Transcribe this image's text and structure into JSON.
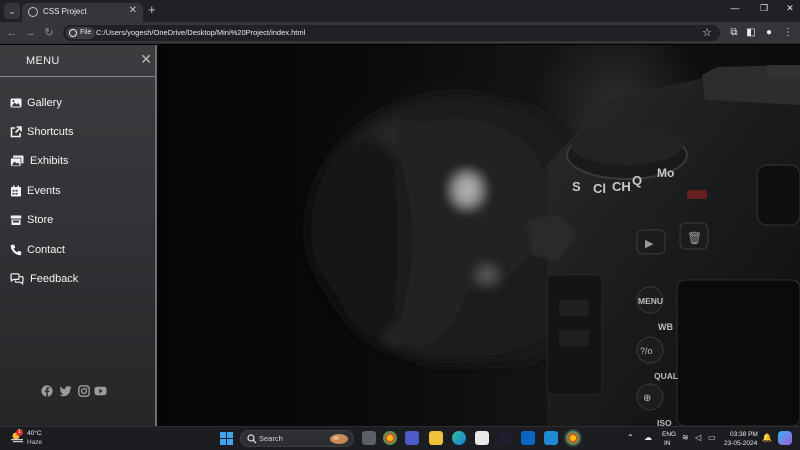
{
  "browser": {
    "tab_title": "CSS Project",
    "tab_list_icon": "chevron-down-icon",
    "new_tab_label": "+",
    "file_chip": "File",
    "url": "C:/Users/yogesh/OneDrive/Desktop/Mini%20Project/index.html"
  },
  "sidebar": {
    "title": "MENU",
    "close_label": "✕",
    "items": [
      {
        "label": "Gallery",
        "icon": "image-icon"
      },
      {
        "label": "Shortcuts",
        "icon": "external-link-icon"
      },
      {
        "label": "Exhibits",
        "icon": "images-icon"
      },
      {
        "label": "Events",
        "icon": "calendar-icon"
      },
      {
        "label": "Store",
        "icon": "store-icon"
      },
      {
        "label": "Contact",
        "icon": "phone-icon"
      },
      {
        "label": "Feedback",
        "icon": "comments-icon"
      }
    ],
    "social": [
      "facebook-icon",
      "twitter-icon",
      "instagram-icon",
      "youtube-icon"
    ]
  },
  "hero": {
    "camera_labels": [
      "MENU",
      "WB",
      "QUAL",
      "ISO"
    ]
  },
  "taskbar": {
    "weather_temp": "40°C",
    "weather_condition": "Haze",
    "search_label": "Search",
    "language": "ENG",
    "region": "IN",
    "time": "03:38 PM",
    "date": "23-05-2024",
    "weather_badge": "1"
  },
  "colors": {
    "sidebar_bg": "#36373a",
    "page_bg": "#050505",
    "taskbar_bg": "#1c1d20",
    "chrome_bg": "#202124"
  }
}
